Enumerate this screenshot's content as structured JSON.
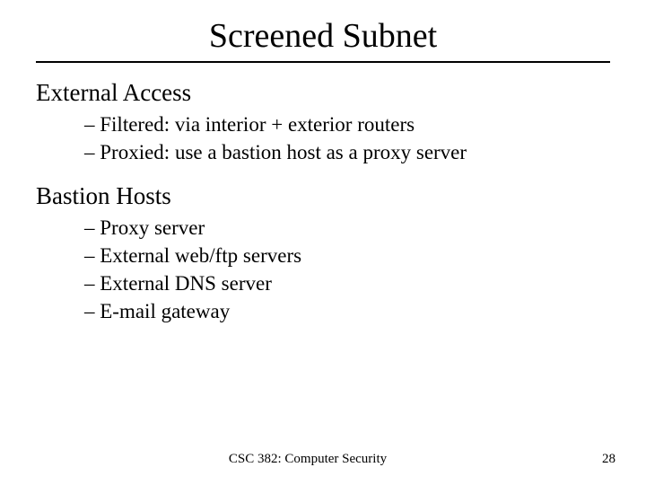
{
  "title": "Screened Subnet",
  "sections": [
    {
      "heading": "External Access",
      "bullets": [
        "Filtered: via interior + exterior routers",
        "Proxied: use a bastion host as a proxy server"
      ]
    },
    {
      "heading": "Bastion Hosts",
      "bullets": [
        "Proxy server",
        "External web/ftp servers",
        "External DNS server",
        "E-mail gateway"
      ]
    }
  ],
  "footer": "CSC 382: Computer Security",
  "page_number": "28"
}
